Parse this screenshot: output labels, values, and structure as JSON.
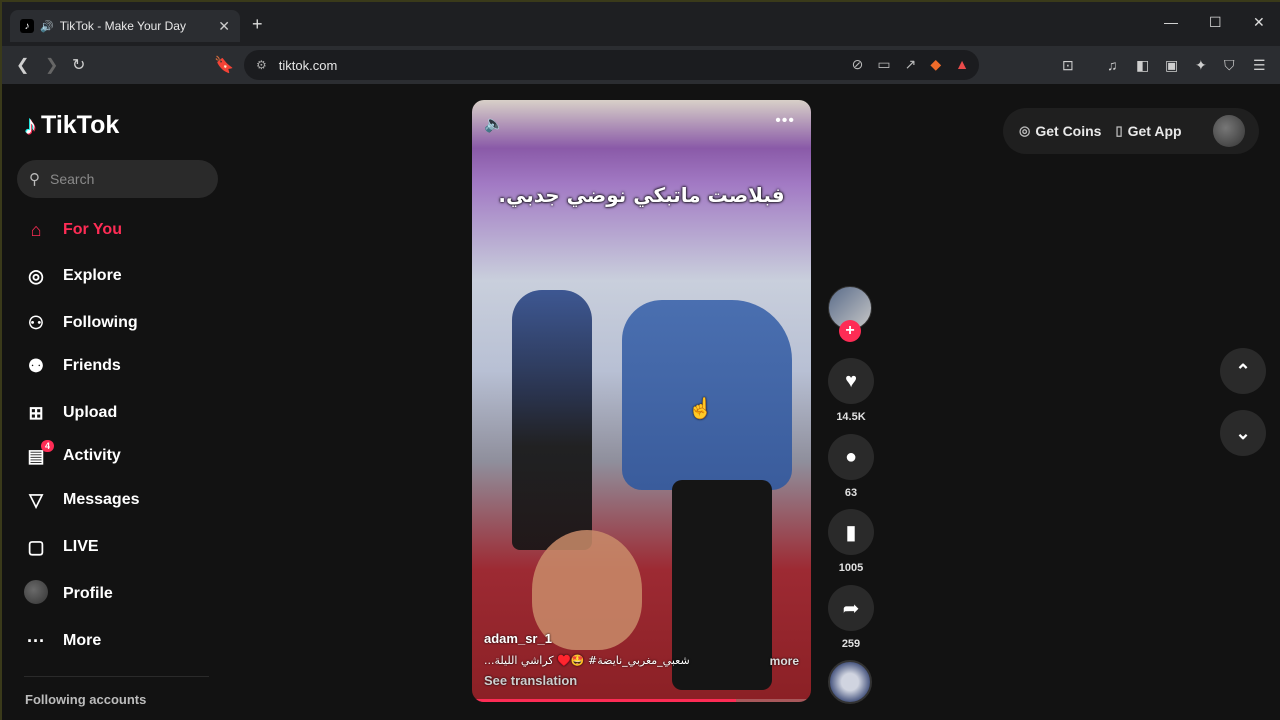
{
  "browser": {
    "tab_title": "TikTok - Make Your Day",
    "url": "tiktok.com"
  },
  "sidebar": {
    "logo": "TikTok",
    "search_placeholder": "Search",
    "items": [
      {
        "label": "For You",
        "icon": "home-icon",
        "active": true
      },
      {
        "label": "Explore",
        "icon": "compass-icon"
      },
      {
        "label": "Following",
        "icon": "user-follow-icon"
      },
      {
        "label": "Friends",
        "icon": "friends-icon"
      },
      {
        "label": "Upload",
        "icon": "plus-square-icon"
      },
      {
        "label": "Activity",
        "icon": "activity-icon",
        "badge": "4"
      },
      {
        "label": "Messages",
        "icon": "send-icon"
      },
      {
        "label": "LIVE",
        "icon": "tv-icon"
      },
      {
        "label": "Profile",
        "icon": "avatar-icon"
      },
      {
        "label": "More",
        "icon": "ellipsis-icon"
      }
    ],
    "following_accounts": "Following accounts"
  },
  "video": {
    "caption_overlay": "فبلاصت ماتبكي نوضي جدبي.",
    "author": "adam_sr_1",
    "description": "...شعبي_مغربي_نايضة# 🤩♥️ كراشي الليلة",
    "more": "more",
    "see_translation": "See translation",
    "progress": 0.78
  },
  "actions": {
    "likes": "14.5K",
    "comments": "63",
    "saves": "1005",
    "shares": "259"
  },
  "topbar": {
    "get_coins": "Get Coins",
    "get_app": "Get App"
  },
  "colors": {
    "accent": "#fe2c55",
    "background": "#121212"
  }
}
